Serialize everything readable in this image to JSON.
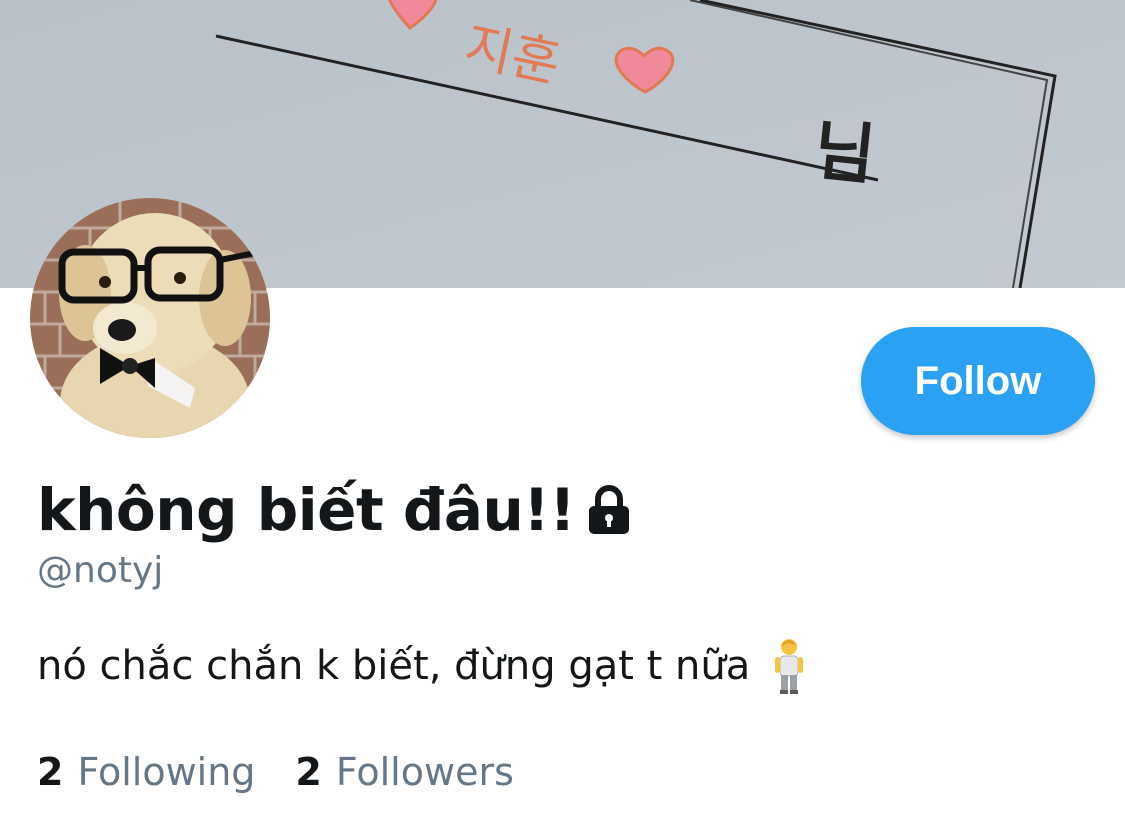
{
  "profile": {
    "display_name": "không biết đâu!!",
    "handle": "@notyj",
    "bio": "nó chắc chắn k biết, đừng gạt t nữa",
    "bio_emoji": "person-standing-emoji",
    "protected_icon": "lock-icon"
  },
  "banner": {
    "text_name": "지훈",
    "text_suffix": "님",
    "heart_color": "#f08a9a"
  },
  "actions": {
    "follow_label": "Follow"
  },
  "stats": {
    "following_count": "2",
    "following_label": "Following",
    "followers_count": "2",
    "followers_label": "Followers"
  },
  "colors": {
    "accent": "#2aa1f2",
    "text_primary": "#14171a",
    "text_secondary": "#657786"
  }
}
